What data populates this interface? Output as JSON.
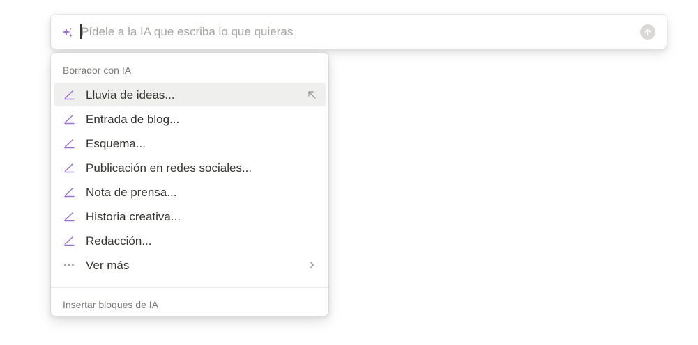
{
  "prompt": {
    "placeholder": "Pídele a la IA que escriba lo que quieras",
    "value": ""
  },
  "menu": {
    "section_draft_title": "Borrador con IA",
    "items": [
      {
        "label": "Lluvia de ideas...",
        "icon": "pencil-icon",
        "active": true
      },
      {
        "label": "Entrada de blog...",
        "icon": "pencil-icon"
      },
      {
        "label": "Esquema...",
        "icon": "pencil-icon"
      },
      {
        "label": "Publicación en redes sociales...",
        "icon": "pencil-icon"
      },
      {
        "label": "Nota de prensa...",
        "icon": "pencil-icon"
      },
      {
        "label": "Historia creativa...",
        "icon": "pencil-icon"
      },
      {
        "label": "Redacción...",
        "icon": "pencil-icon"
      },
      {
        "label": "Ver más",
        "icon": "more-dots-icon"
      }
    ],
    "section_blocks_title": "Insertar bloques de IA"
  },
  "colors": {
    "accent": "#9a6dd7",
    "hover_bg": "#efefee",
    "muted_text": "#787774"
  }
}
